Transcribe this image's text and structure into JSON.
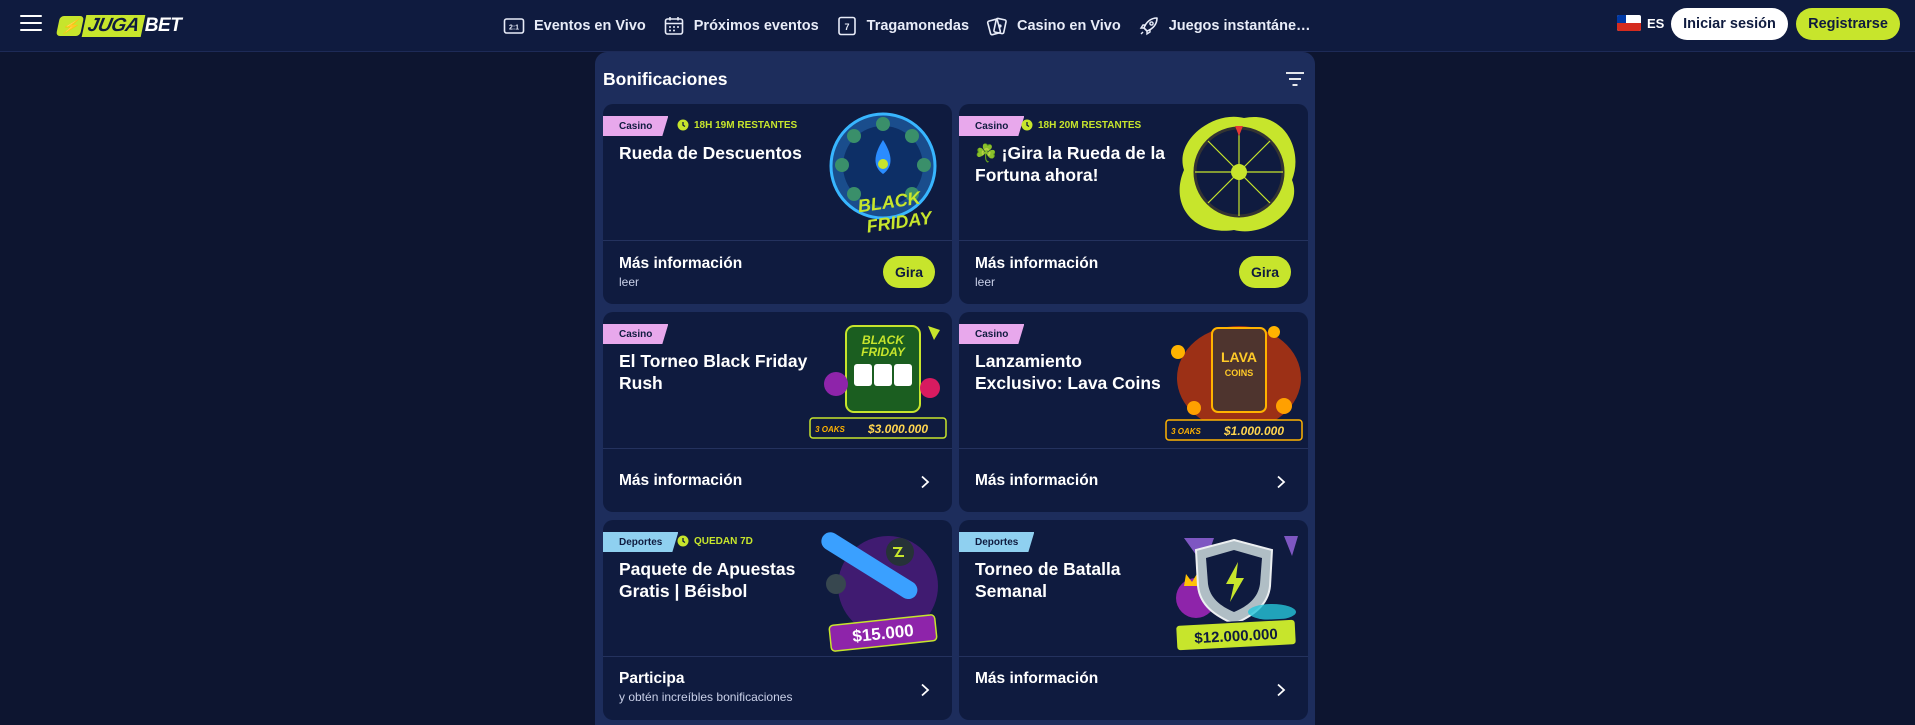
{
  "header": {
    "logo_text": "JUGABET",
    "logo_juga": "JUGA",
    "logo_bet": "BET",
    "nav": [
      {
        "label": "Eventos en Vivo",
        "icon": "live-scoreboard-icon"
      },
      {
        "label": "Próximos eventos",
        "icon": "calendar-icon"
      },
      {
        "label": "Tragamonedas",
        "icon": "slot-machine-icon"
      },
      {
        "label": "Casino en Vivo",
        "icon": "playing-cards-icon"
      },
      {
        "label": "Juegos instantáne…",
        "icon": "rocket-icon"
      }
    ],
    "language": "ES",
    "flag": "chile-flag-icon",
    "login_label": "Iniciar sesión",
    "register_label": "Registrarse"
  },
  "panel": {
    "title": "Bonificaciones"
  },
  "cards": [
    {
      "tag": "Casino",
      "timer": "18H 19M RESTANTES",
      "title": "Rueda de Descuentos",
      "footer_title": "Más información",
      "footer_sub": "leer",
      "action": "Gira",
      "art": "black-friday-wheel"
    },
    {
      "tag": "Casino",
      "timer": "18H 20M RESTANTES",
      "title": "☘️ ¡Gira la Rueda de la Fortuna ahora!",
      "footer_title": "Más información",
      "footer_sub": "leer",
      "action": "Gira",
      "art": "fortune-wheel"
    },
    {
      "tag": "Casino",
      "timer": "",
      "title": "El Torneo Black Friday Rush",
      "footer_title": "Más información",
      "footer_sub": "",
      "art": "black-friday-slot",
      "prize": "$3.000.000",
      "provider": "3 OAKS"
    },
    {
      "tag": "Casino",
      "timer": "",
      "title": "Lanzamiento Exclusivo: Lava Coins",
      "footer_title": "Más información",
      "footer_sub": "",
      "art": "lava-coins-slot",
      "prize": "$1.000.000",
      "provider": "3 OAKS"
    },
    {
      "tag": "Deportes",
      "timer": "QUEDAN 7D",
      "title": "Paquete de Apuestas Gratis | Béisbol",
      "footer_title": "Participa",
      "footer_sub": "y obtén increíbles bonificaciones",
      "art": "baseball-bat",
      "prize": "$15.000"
    },
    {
      "tag": "Deportes",
      "timer": "",
      "title": "Torneo de Batalla Semanal",
      "footer_title": "Más información",
      "footer_sub": "",
      "art": "battle-shield",
      "prize": "$12.000.000"
    }
  ],
  "colors": {
    "accent": "#c7e52c",
    "bg": "#0d1530",
    "header": "#0f1b3f",
    "panel": "#1d2d5c",
    "card": "#0f1b3f",
    "tag_casino": "#e8a8ec",
    "tag_deportes": "#8fd0f0"
  }
}
